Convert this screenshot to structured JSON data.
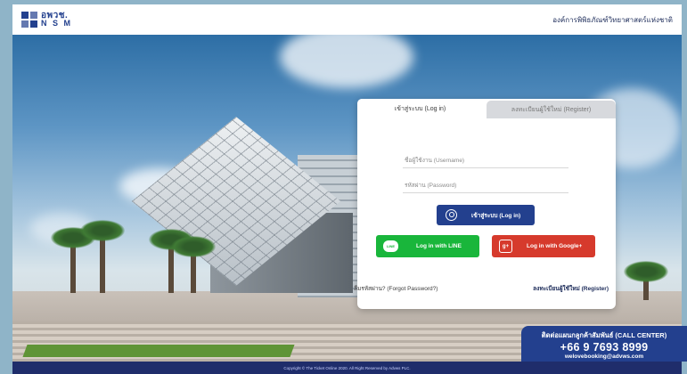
{
  "header": {
    "logo_line1": "อพวช.",
    "logo_line2": "N S M",
    "org_name": "องค์การพิพิธภัณฑ์วิทยาศาสตร์แห่งชาติ"
  },
  "login": {
    "tabs": [
      "เข้าสู่ระบบ (Log in)",
      "ลงทะเบียนผู้ใช้ใหม่ (Register)"
    ],
    "username_placeholder": "ชื่อผู้ใช้งาน (Username)",
    "password_placeholder": "รหัสผ่าน (Password)",
    "login_button": "เข้าสู่ระบบ (Log in)",
    "line_button": "Log in with LINE",
    "line_icon_text": "LINE",
    "google_button": "Log in with Google+",
    "google_icon_text": "g+",
    "forgot_link": "ลืมรหัสผ่าน? (Forgot Password?)",
    "register_link": "ลงทะเบียนผู้ใช้ใหม่ (Register)"
  },
  "callcenter": {
    "label": "ติดต่อแผนกลูกค้าสัมพันธ์ (CALL CENTER)",
    "phone": "+66 9 7693 8999",
    "email": "welovebooking@advws.com"
  },
  "footer": {
    "text": "Copyright © The Ticket Online 2020. All Right Reserved by Advws PLC."
  },
  "colors": {
    "brand_blue": "#23408e",
    "line_green": "#19b63b",
    "google_red": "#d63a2c",
    "footer_bg": "#1f2d6b"
  }
}
